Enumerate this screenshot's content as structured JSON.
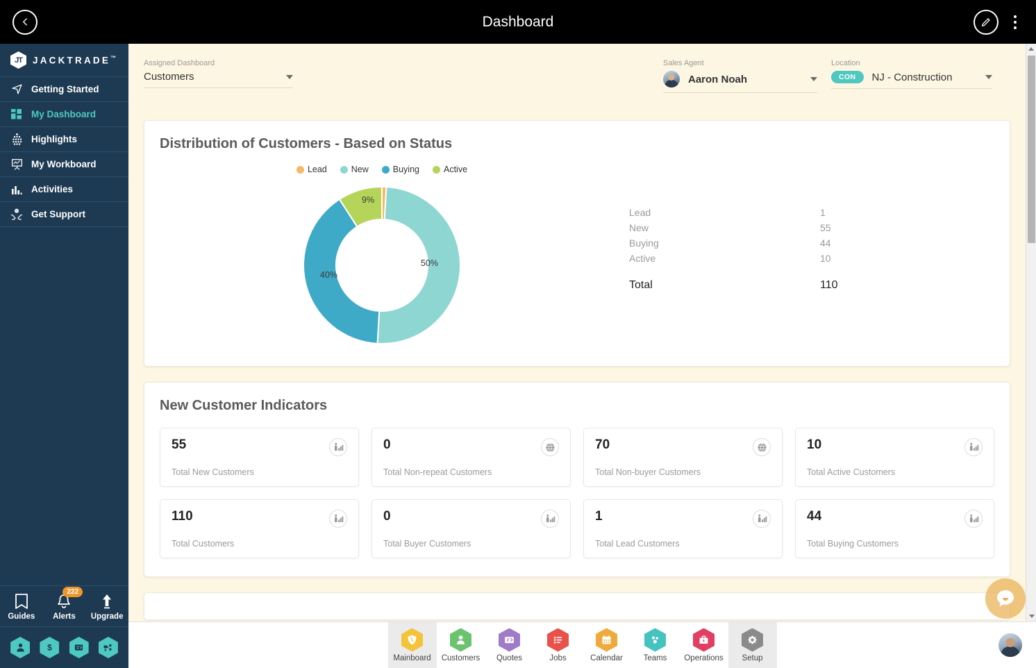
{
  "topbar": {
    "title": "Dashboard",
    "back_icon": "chevron-left-icon",
    "edit_icon": "pencil-icon",
    "menu_icon": "more-vertical-icon"
  },
  "sidebar": {
    "brand": {
      "mark": "JT",
      "name": "JACKTRADE",
      "tm": "™"
    },
    "items": [
      {
        "label": "Getting Started",
        "icon": "navigation-arrow-icon",
        "active": false
      },
      {
        "label": "My Dashboard",
        "icon": "grid-squares-icon",
        "active": true
      },
      {
        "label": "Highlights",
        "icon": "dots-grid-icon",
        "active": false
      },
      {
        "label": "My Workboard",
        "icon": "presentation-chart-icon",
        "active": false
      },
      {
        "label": "Activities",
        "icon": "bar-chart-icon",
        "active": false
      },
      {
        "label": "Get Support",
        "icon": "support-hands-icon",
        "active": false
      }
    ],
    "utilities": [
      {
        "label": "Guides",
        "icon": "book-icon",
        "badge": ""
      },
      {
        "label": "Alerts",
        "icon": "bell-icon",
        "badge": "222"
      },
      {
        "label": "Upgrade",
        "icon": "arrow-up-icon",
        "badge": ""
      }
    ],
    "quick_hexes": [
      {
        "icon": "person-icon"
      },
      {
        "icon": "dollar-icon"
      },
      {
        "icon": "quote-card-icon"
      },
      {
        "icon": "workflow-icon"
      }
    ],
    "accent_color": "#4ec9c0",
    "bg_color": "#1d3a52"
  },
  "filters": {
    "assigned_dashboard": {
      "label": "Assigned Dashboard",
      "value": "Customers"
    },
    "sales_agent": {
      "label": "Sales Agent",
      "value": "Aaron Noah",
      "avatar": "user-avatar"
    },
    "location": {
      "label": "Location",
      "value": "NJ - Construction",
      "chip": "CON"
    }
  },
  "chart_card": {
    "title": "Distribution of Customers - Based on Status",
    "total_label": "Total",
    "total_value": "110"
  },
  "chart_data": {
    "type": "pie",
    "title": "Distribution of Customers - Based on Status",
    "legend_position": "top",
    "donut": true,
    "categories": [
      "Lead",
      "New",
      "Buying",
      "Active"
    ],
    "values": [
      1,
      55,
      44,
      10
    ],
    "percent_labels": [
      "",
      "50%",
      "40%",
      "9%"
    ],
    "colors": [
      "#f5b969",
      "#8ed6d2",
      "#3fa9c8",
      "#b5d45a"
    ],
    "total": 110
  },
  "indicators_card": {
    "title": "New Customer Indicators",
    "cards": [
      {
        "value": "55",
        "label": "Total New Customers",
        "icon": "people-chart-icon"
      },
      {
        "value": "0",
        "label": "Total Non-repeat Customers",
        "icon": "globe-icon"
      },
      {
        "value": "70",
        "label": "Total Non-buyer Customers",
        "icon": "globe-icon"
      },
      {
        "value": "10",
        "label": "Total Active Customers",
        "icon": "people-chart-icon"
      },
      {
        "value": "110",
        "label": "Total Customers",
        "icon": "people-chart-icon"
      },
      {
        "value": "0",
        "label": "Total Buyer Customers",
        "icon": "people-chart-icon"
      },
      {
        "value": "1",
        "label": "Total Lead Customers",
        "icon": "people-chart-icon"
      },
      {
        "value": "44",
        "label": "Total Buying Customers",
        "icon": "people-chart-icon"
      }
    ]
  },
  "bottom_nav": {
    "items": [
      {
        "label": "Mainboard",
        "icon": "shield-hex-icon",
        "color": "#f5c33b",
        "selected": true
      },
      {
        "label": "Customers",
        "icon": "person-hex-icon",
        "color": "#6cc36e",
        "selected": false
      },
      {
        "label": "Quotes",
        "icon": "quote-hex-icon",
        "color": "#a07bc8",
        "selected": false
      },
      {
        "label": "Jobs",
        "icon": "list-hex-icon",
        "color": "#e9524a",
        "selected": false
      },
      {
        "label": "Calendar",
        "icon": "calendar-hex-icon",
        "color": "#f0a93b",
        "selected": false
      },
      {
        "label": "Teams",
        "icon": "teams-hex-icon",
        "color": "#45c3c0",
        "selected": false
      },
      {
        "label": "Operations",
        "icon": "briefcase-hex-icon",
        "color": "#e23d62",
        "selected": false
      },
      {
        "label": "Setup",
        "icon": "gear-hex-icon",
        "color": "#8a8a8a",
        "selected": true
      }
    ]
  },
  "chat": {
    "icon": "chat-bubble-icon",
    "color": "#e9b055"
  }
}
